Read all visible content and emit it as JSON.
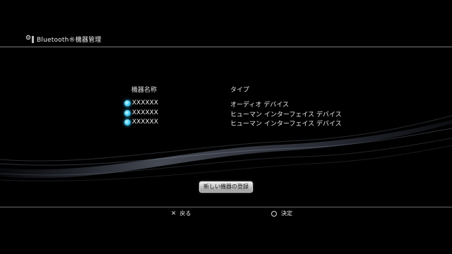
{
  "header": {
    "title": "Bluetooth®機器管理"
  },
  "table": {
    "columns": [
      "機器名称",
      "タイプ"
    ],
    "rows": [
      {
        "name": "XXXXXX",
        "type": "オーディオ デバイス"
      },
      {
        "name": "XXXXXX",
        "type": "ヒューマン インターフェイス デバイス"
      },
      {
        "name": "XXXXXX",
        "type": "ヒューマン インターフェイス デバイス"
      }
    ]
  },
  "register_button": {
    "label": "新しい機器の登録"
  },
  "footer": {
    "back_icon": "✕",
    "back_label": "戻る",
    "enter_label": "決定"
  },
  "colors": {
    "accent": "#4fd2ff",
    "background": "#000000"
  }
}
